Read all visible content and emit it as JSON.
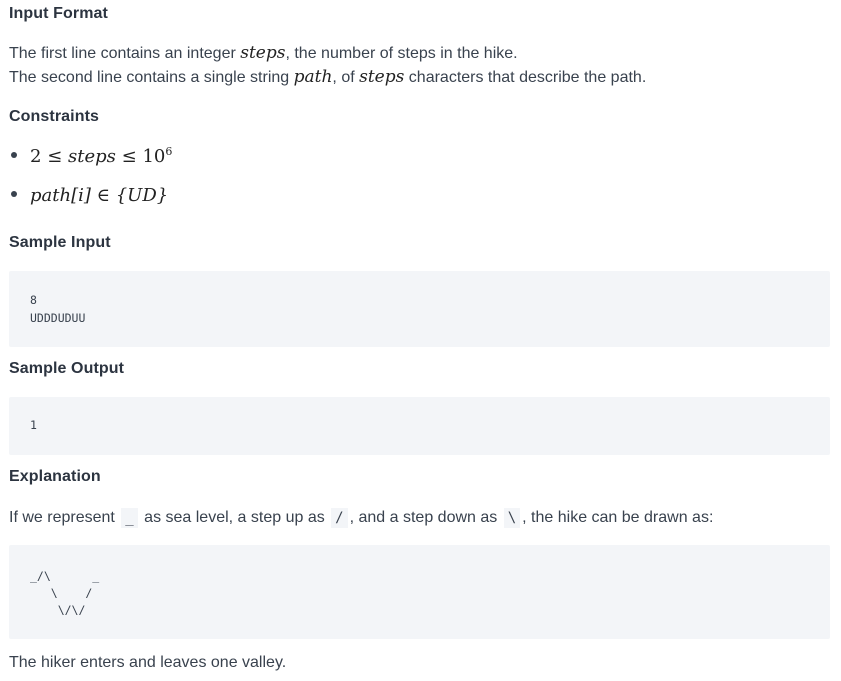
{
  "input_format": {
    "heading": "Input Format",
    "line1": {
      "pre": "The first line contains an integer ",
      "var": "steps",
      "post": ", the number of steps in the hike."
    },
    "line2": {
      "pre": "The second line contains a single string ",
      "var1": "path",
      "mid": ", of ",
      "var2": "steps",
      "post": " characters that describe the path."
    }
  },
  "constraints": {
    "heading": "Constraints",
    "items": [
      {
        "lhs": "2",
        "op1": "≤",
        "var": "steps",
        "op2": "≤",
        "base": "10",
        "exp": "6"
      },
      {
        "var": "path",
        "index": "[i]",
        "op": "∈",
        "set": "{UD}"
      }
    ]
  },
  "sample_input": {
    "heading": "Sample Input",
    "lines": [
      "8",
      "UDDDUDUU"
    ]
  },
  "sample_output": {
    "heading": "Sample Output",
    "lines": [
      "1"
    ]
  },
  "explanation": {
    "heading": "Explanation",
    "text_pre": "If we represent ",
    "code1": "_",
    "text_mid1": " as sea level, a step up as ",
    "code2": "/",
    "text_mid2": ", and a step down as ",
    "code3": "\\",
    "text_post": ", the hike can be drawn as:",
    "diagram_lines": [
      "_/\\      _",
      "   \\    /",
      "    \\/\\/"
    ],
    "conclusion": "The hiker enters and leaves one valley."
  }
}
